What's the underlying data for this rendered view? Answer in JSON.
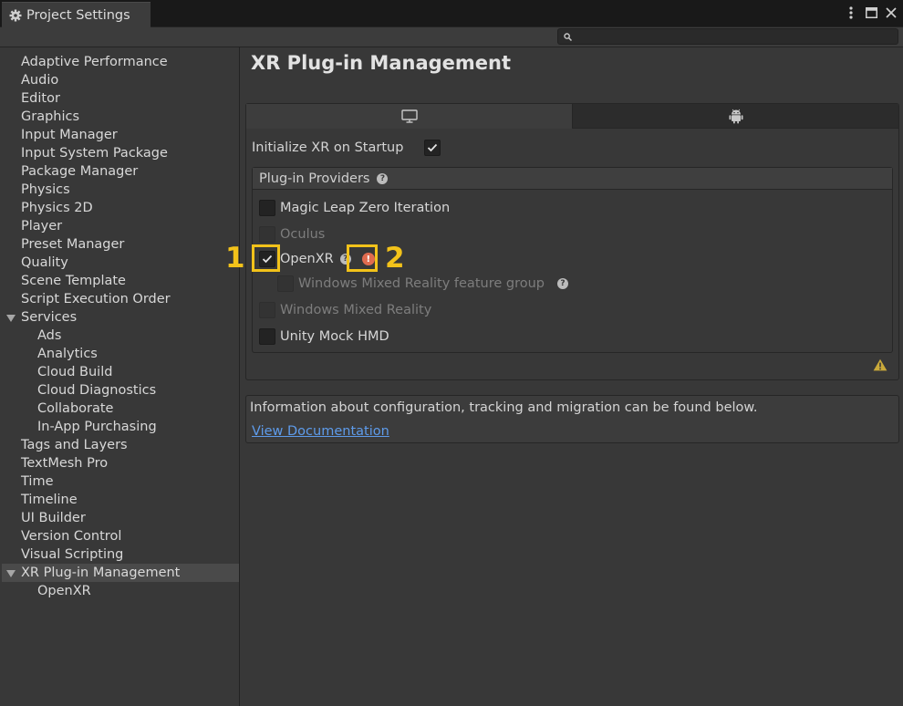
{
  "window": {
    "title": "Project Settings"
  },
  "window_controls": {
    "menu_icon": "kebab-menu-icon",
    "maximize_icon": "maximize-icon",
    "close_icon": "close-icon"
  },
  "search": {
    "placeholder": ""
  },
  "sidebar": {
    "items": [
      {
        "label": "Adaptive Performance",
        "level": 0
      },
      {
        "label": "Audio",
        "level": 0
      },
      {
        "label": "Editor",
        "level": 0
      },
      {
        "label": "Graphics",
        "level": 0
      },
      {
        "label": "Input Manager",
        "level": 0
      },
      {
        "label": "Input System Package",
        "level": 0
      },
      {
        "label": "Package Manager",
        "level": 0
      },
      {
        "label": "Physics",
        "level": 0
      },
      {
        "label": "Physics 2D",
        "level": 0
      },
      {
        "label": "Player",
        "level": 0
      },
      {
        "label": "Preset Manager",
        "level": 0
      },
      {
        "label": "Quality",
        "level": 0
      },
      {
        "label": "Scene Template",
        "level": 0
      },
      {
        "label": "Script Execution Order",
        "level": 0
      },
      {
        "label": "Services",
        "level": 0,
        "expanded": true
      },
      {
        "label": "Ads",
        "level": 1
      },
      {
        "label": "Analytics",
        "level": 1
      },
      {
        "label": "Cloud Build",
        "level": 1
      },
      {
        "label": "Cloud Diagnostics",
        "level": 1
      },
      {
        "label": "Collaborate",
        "level": 1
      },
      {
        "label": "In-App Purchasing",
        "level": 1
      },
      {
        "label": "Tags and Layers",
        "level": 0
      },
      {
        "label": "TextMesh Pro",
        "level": 0
      },
      {
        "label": "Time",
        "level": 0
      },
      {
        "label": "Timeline",
        "level": 0
      },
      {
        "label": "UI Builder",
        "level": 0
      },
      {
        "label": "Version Control",
        "level": 0
      },
      {
        "label": "Visual Scripting",
        "level": 0
      },
      {
        "label": "XR Plug-in Management",
        "level": 0,
        "expanded": true,
        "selected": true
      },
      {
        "label": "OpenXR",
        "level": 1
      }
    ]
  },
  "main": {
    "title": "XR Plug-in Management",
    "platform_tabs": [
      {
        "icon": "desktop-icon",
        "active": true
      },
      {
        "icon": "android-icon",
        "active": false
      }
    ],
    "initialize": {
      "label": "Initialize XR on Startup",
      "checked": true
    },
    "providers": {
      "header": "Plug-in Providers",
      "items": [
        {
          "label": "Magic Leap Zero Iteration",
          "checked": false,
          "enabled": true
        },
        {
          "label": "Oculus",
          "checked": false,
          "enabled": false
        },
        {
          "label": "OpenXR",
          "checked": true,
          "enabled": true,
          "has_help": true,
          "has_error": true
        },
        {
          "label": "Windows Mixed Reality feature group",
          "checked": false,
          "enabled": false,
          "indent": true,
          "has_help": true
        },
        {
          "label": "Windows Mixed Reality",
          "checked": false,
          "enabled": false,
          "has_warning": true
        },
        {
          "label": "Unity Mock HMD",
          "checked": false,
          "enabled": true
        }
      ]
    },
    "annotations": {
      "label_1": "1",
      "label_2": "2"
    },
    "info": {
      "text": "Information about configuration, tracking and migration can be found below.",
      "link": "View Documentation"
    }
  },
  "colors": {
    "highlight": "#f2c21a",
    "link": "#5e9bea",
    "error": "#e06b4f",
    "warning": "#c9a93a"
  }
}
